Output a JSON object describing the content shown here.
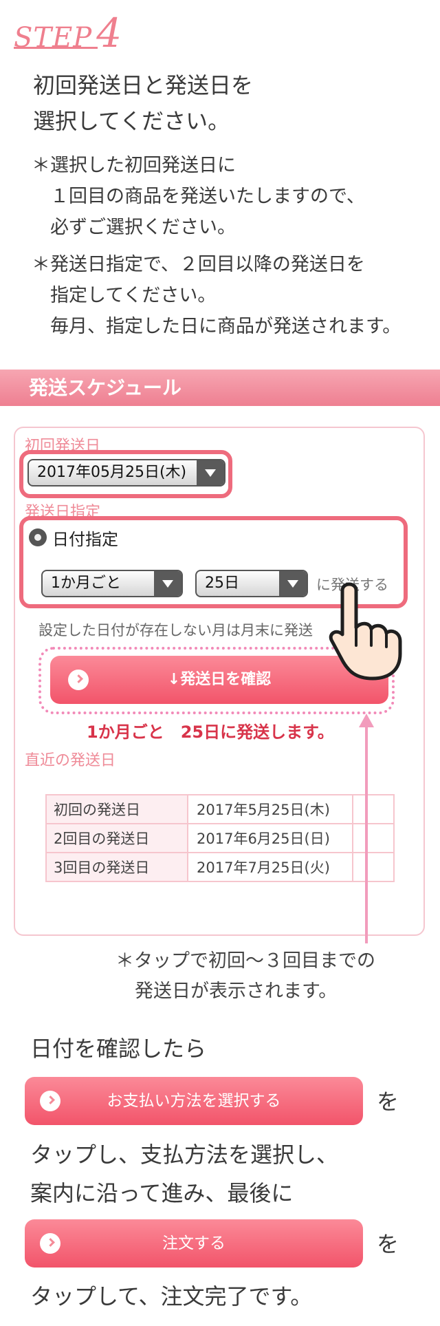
{
  "step": {
    "word": "STEP",
    "number": "4"
  },
  "intro": {
    "line1": "初回発送日と発送日を",
    "line2": "選択してください。"
  },
  "notes": {
    "n1a": "＊選択した初回発送日に",
    "n1b": "　１回目の商品を発送いたしますので、",
    "n1c": "　必ずご選択ください。",
    "n2a": "＊発送日指定で、２回目以降の発送日を",
    "n2b": "　指定してください。",
    "n2c": "　毎月、指定した日に商品が発送されます。"
  },
  "banner_title": "発送スケジュール",
  "panel": {
    "first_ship_label": "初回発送日",
    "first_ship_value": "2017年05月25日(木)",
    "ship_day_label": "発送日指定",
    "radio_label": "日付指定",
    "interval_value": "1か月ごと",
    "day_value": "25日",
    "ship_suffix": "に発送する",
    "month_end_note": "設定した日付が存在しない月は月末に発送",
    "confirm_button": "↓発送日を確認",
    "result_text": "1か月ごと　25日に発送します。",
    "recent_label": "直近の発送日",
    "schedule": [
      {
        "label": "初回の発送日",
        "date": "2017年5月25日(木)"
      },
      {
        "label": "2回目の発送日",
        "date": "2017年6月25日(日)"
      },
      {
        "label": "3回目の発送日",
        "date": "2017年7月25日(火)"
      }
    ]
  },
  "tap_note": {
    "line1": "＊タップで初回〜３回目までの",
    "line2": "発送日が表示されます。"
  },
  "outro": {
    "line1": "日付を確認したら",
    "pay_button": "お支払い方法を選択する",
    "wo1": "を",
    "line2": "タップし、支払方法を選択し、",
    "line3": "案内に沿って進み、最後に",
    "order_button": "注文する",
    "wo2": "を",
    "line4": "タップして、注文完了です。"
  },
  "colors": {
    "accent": "#ee6b7d",
    "button": "#f2546a",
    "result": "#d8344a",
    "arrow": "#f29cbc"
  }
}
